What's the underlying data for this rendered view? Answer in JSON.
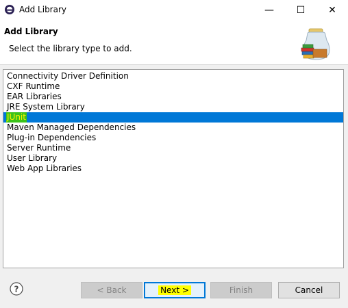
{
  "window": {
    "title": "Add Library",
    "icon": "eclipse-icon",
    "controls": {
      "minimize": "—",
      "maximize": "☐",
      "close": "✕"
    }
  },
  "header": {
    "title": "Add Library",
    "description": "Select the library type to add.",
    "image": "library-books-jar-icon"
  },
  "library_types": {
    "items": [
      "Connectivity Driver Definition",
      "CXF Runtime",
      "EAR Libraries",
      "JRE System Library",
      "JUnit",
      "Maven Managed Dependencies",
      "Plug-in Dependencies",
      "Server Runtime",
      "User Library",
      "Web App Libraries"
    ],
    "selected": "JUnit"
  },
  "buttons": {
    "help": "?",
    "back": "< Back",
    "next": "Next >",
    "finish": "Finish",
    "cancel": "Cancel"
  },
  "colors": {
    "selection": "#0078d7",
    "highlight_green": "#3bc21a",
    "highlight_yellow": "#ffff00"
  }
}
